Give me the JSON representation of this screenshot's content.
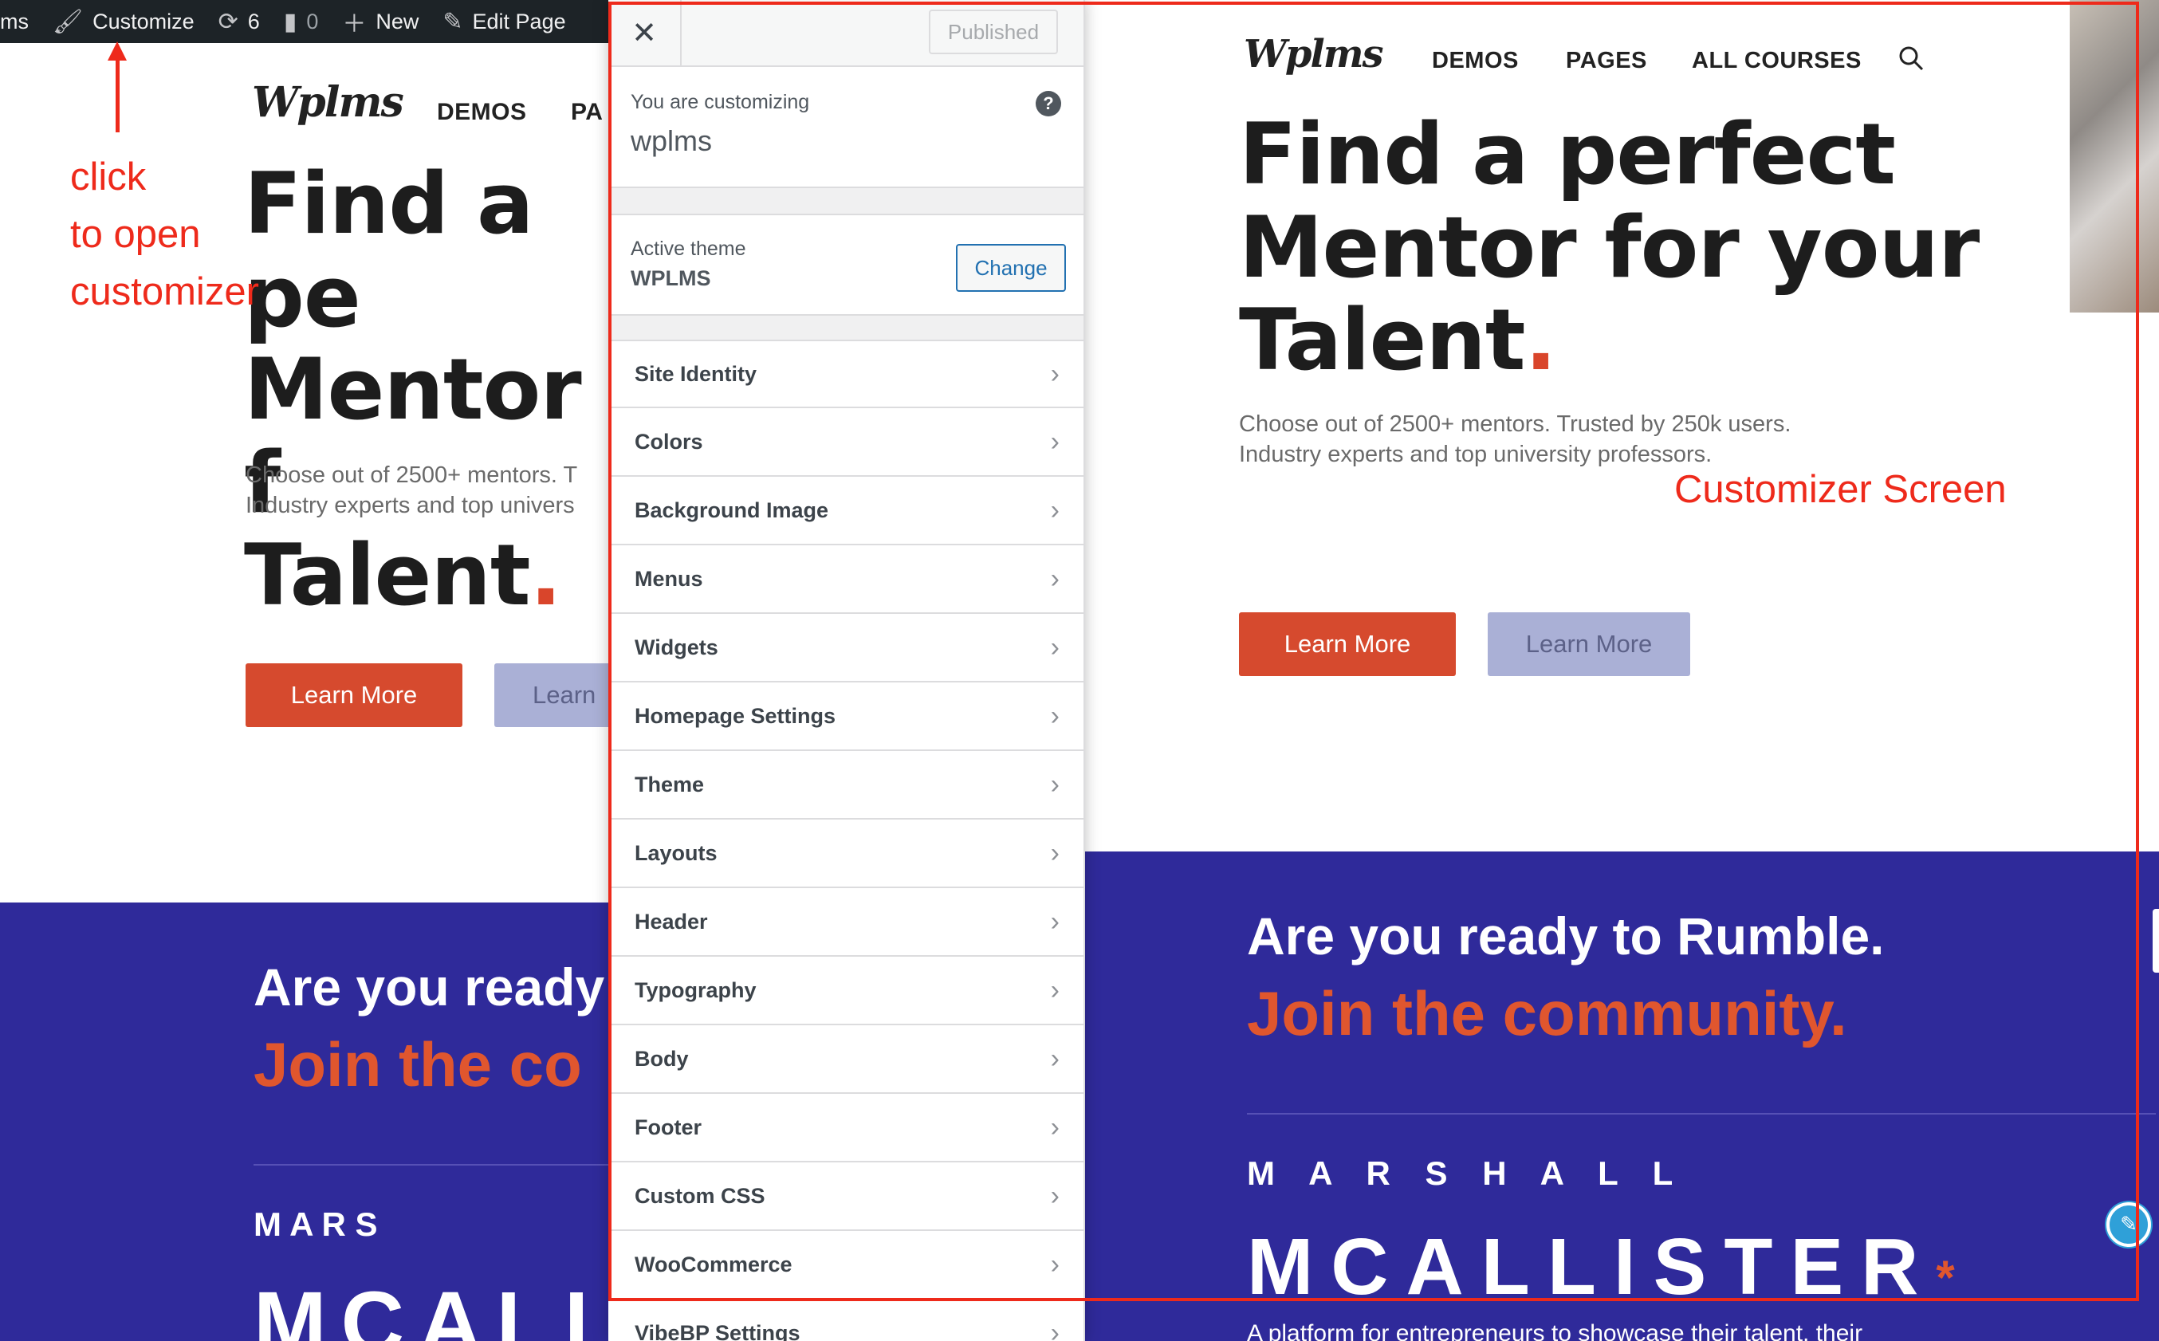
{
  "admin_bar": {
    "site_fragment": "ms",
    "customize_label": "Customize",
    "updates_count": "6",
    "comments_count": "0",
    "new_label": "New",
    "edit_label": "Edit Page"
  },
  "annotations": {
    "click_lines": [
      "click",
      "to open",
      "customizer"
    ],
    "customizer_screen": "Customizer Screen"
  },
  "background_page": {
    "logo": "Wplms",
    "nav": [
      "DEMOS",
      "PA"
    ],
    "hero_title": "Find a pe\nMentor f\nTalent",
    "hero_dot": ".",
    "hero_sub": "Choose out of 2500+ mentors. T\nIndustry experts and top univers",
    "primary_button": "Learn More",
    "secondary_button": "Learn",
    "rumble_line1": "Are you ready",
    "rumble_line2": "Join the co",
    "marshall": "M   A   R   S",
    "mcallister": "MCALL"
  },
  "customizer": {
    "close_icon": "close-icon",
    "published_label": "Published",
    "customizing_label": "You are customizing",
    "site_name": "wplms",
    "help_icon": "?",
    "active_theme_label": "Active theme",
    "active_theme_name": "WPLMS",
    "change_button": "Change",
    "sections": [
      "Site Identity",
      "Colors",
      "Background Image",
      "Menus",
      "Widgets",
      "Homepage Settings",
      "Theme",
      "Layouts",
      "Header",
      "Typography",
      "Body",
      "Footer",
      "Custom CSS",
      "WooCommerce",
      "VibeBP Settings"
    ]
  },
  "preview": {
    "logo": "Wplms",
    "nav": [
      "DEMOS",
      "PAGES",
      "ALL COURSES"
    ],
    "hero_title": "Find a perfect\nMentor for your\nTalent",
    "hero_dot": ".",
    "hero_sub": "Choose out of 2500+ mentors. Trusted by 250k users.\nIndustry experts and top university professors.",
    "primary_button": "Learn More",
    "secondary_button": "Learn More",
    "rumble_line1": "Are you ready to Rumble.",
    "rumble_line2": "Join the community.",
    "marshall": "M   A   R   S   H   A   L   L",
    "mcallister": "MCALLISTER",
    "asterisk": "*",
    "tagline_fragment": "A platform for entrepreneurs to showcase their talent, their"
  },
  "colors": {
    "accent_red": "#d64a2e",
    "purple": "#2f2a9a",
    "annotation_red": "#ee2a1b",
    "wp_blue": "#2271b1"
  }
}
